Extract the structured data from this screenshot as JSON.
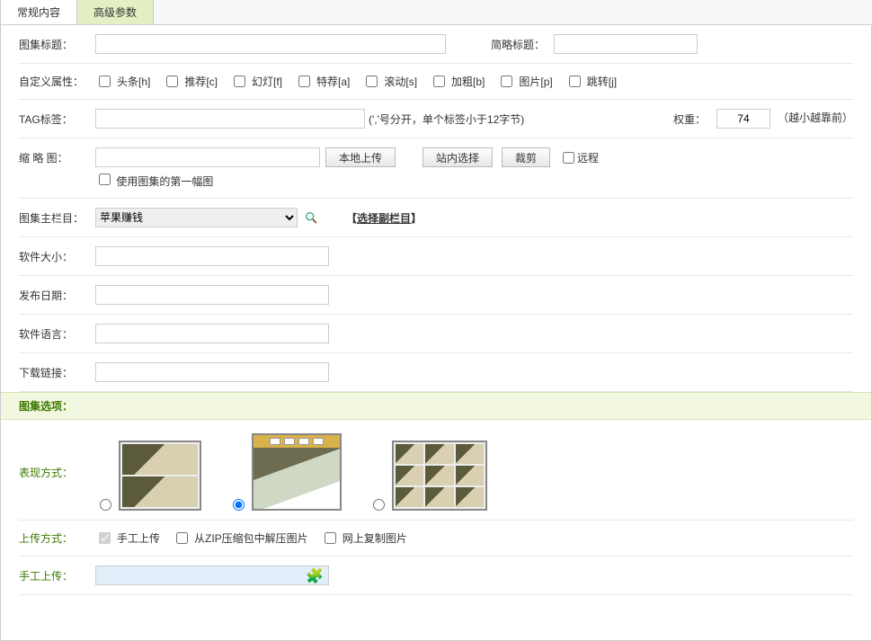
{
  "tabs": {
    "normal": "常规内容",
    "advanced": "高级参数"
  },
  "labels": {
    "title": "图集标题：",
    "simple": "简略标题：",
    "attrs": "自定义属性：",
    "tag": "TAG标签：",
    "weight": "权重：",
    "thumb": "缩 略 图：",
    "main_col": "图集主栏目：",
    "size": "软件大小：",
    "date": "发布日期：",
    "lang": "软件语言：",
    "download": "下载链接：",
    "display": "表现方式：",
    "upload": "上传方式：",
    "manual": "手工上传："
  },
  "attrs": {
    "headline": "头条[h]",
    "recommend": "推荐[c]",
    "slide": "幻灯[f]",
    "special": "特荐[a]",
    "scroll": "滚动[s]",
    "bold": "加粗[b]",
    "image": "图片[p]",
    "jump": "跳转[j]"
  },
  "tagHint": "(','号分开，单个标签小于12字节)",
  "weight": {
    "value": "74",
    "hint": "（越小越靠前）"
  },
  "thumb": {
    "local": "本地上传",
    "inner": "站内选择",
    "crop": "裁剪",
    "remote": "远程",
    "first": "使用图集的第一幅图"
  },
  "mainCol": {
    "selected": "苹果赚钱",
    "sub": "【",
    "subText": "选择副栏目",
    "subEnd": "】"
  },
  "section": "图集选项：",
  "uploadOpts": {
    "manual": "手工上传",
    "zip": "从ZIP压缩包中解压图片",
    "web": "网上复制图片"
  }
}
